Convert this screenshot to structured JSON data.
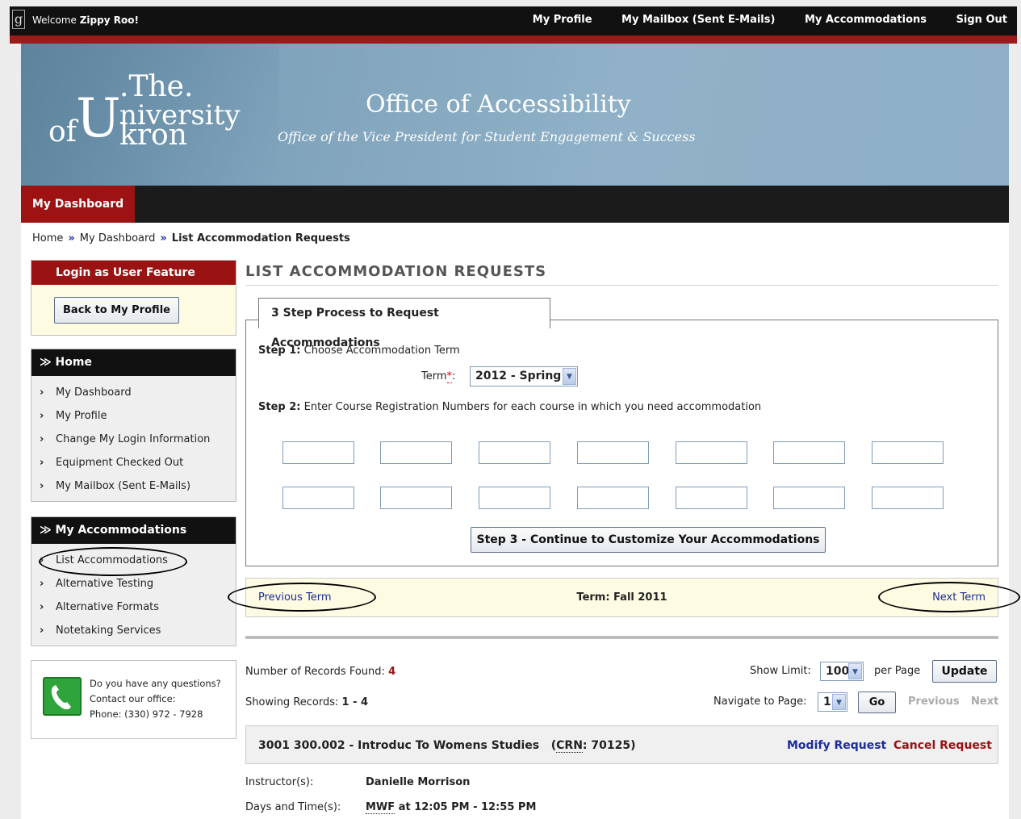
{
  "topbar": {
    "welcome_prefix": "Welcome",
    "user_name": "Zippy Roo!",
    "nav": [
      "My Profile",
      "My Mailbox (Sent E-Mails)",
      "My Accommodations",
      "Sign Out"
    ]
  },
  "banner": {
    "logo": {
      "the": ".The.",
      "of": "of",
      "u": "U",
      "niversity": "niversity",
      "kron": "kron"
    },
    "title": "Office of Accessibility",
    "subtitle": "Office of the Vice President for Student Engagement & Success"
  },
  "menubar": {
    "dashboard": "My Dashboard"
  },
  "breadcrumb": {
    "home": "Home",
    "sep": "»",
    "dashboard": "My Dashboard",
    "current": "List Accommodation Requests"
  },
  "sidebar": {
    "login_box": {
      "title": "Login as User Feature",
      "button": "Back to My Profile"
    },
    "home_box": {
      "title": "Home",
      "items": [
        "My Dashboard",
        "My Profile",
        "Change My Login Information",
        "Equipment Checked Out",
        "My Mailbox (Sent E-Mails)"
      ]
    },
    "accom_box": {
      "title": "My Accommodations",
      "items": [
        "List Accommodations",
        "Alternative Testing",
        "Alternative Formats",
        "Notetaking Services"
      ]
    },
    "contact": {
      "line1": "Do you have any questions?",
      "line2": "Contact our office:",
      "line3": "Phone: (330) 972 - 7928"
    }
  },
  "main": {
    "title": "LIST ACCOMMODATION REQUESTS",
    "tab": "3 Step Process to Request Accommodations",
    "step1_label": "Step 1:",
    "step1_text": "Choose Accommodation Term",
    "term_label": "Term",
    "term_req": "*",
    "term_colon": ":",
    "term_value": "2012 - Spring",
    "step2_label": "Step 2:",
    "step2_text": "Enter Course Registration Numbers for each course in which you need accommodation",
    "step3_button": "Step 3 - Continue to Customize Your Accommodations",
    "term_nav": {
      "prev": "Previous Term",
      "current": "Term: Fall 2011",
      "next": "Next Term"
    },
    "records": {
      "found_label": "Number of Records Found:",
      "found_value": "4",
      "showing_label": "Showing Records:",
      "showing_value": "1 - 4",
      "limit_label": "Show Limit:",
      "limit_value": "100",
      "per_page": "per Page",
      "update": "Update",
      "nav_label": "Navigate to Page:",
      "page_value": "1",
      "go": "Go",
      "previous": "Previous",
      "next": "Next"
    },
    "course": {
      "name": "3001 300.002 - Introduc To Womens Studies",
      "crn_open": "(",
      "crn_label": "CRN",
      "crn_value": ": 70125)",
      "modify": "Modify Request",
      "cancel": "Cancel Request",
      "instructor_label": "Instructor(s):",
      "instructor_value": "Danielle Morrison",
      "days_label": "Days and Time(s):",
      "days_abbr": "MWF",
      "days_value": " at 12:05 PM - 12:55 PM"
    }
  },
  "icons": {
    "chevron": "›",
    "double_chevron": "≫",
    "select_arrow": "▼"
  },
  "colors": {
    "accent_red": "#9a1212",
    "link_blue": "#1d2c9c",
    "banner_blue": "#8eafc5",
    "note_yellow": "#fdfbe2"
  }
}
